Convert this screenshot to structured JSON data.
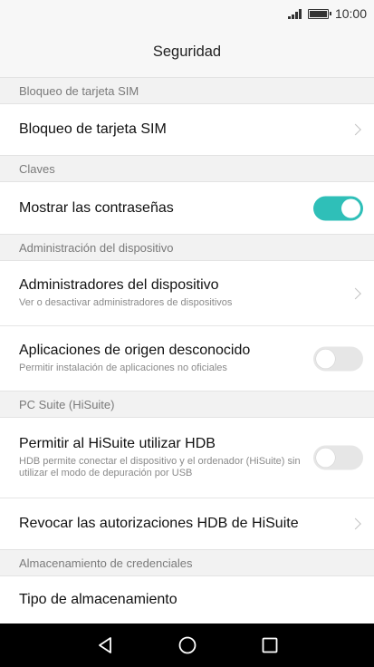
{
  "status_bar": {
    "time": "10:00",
    "icons": [
      "signal-icon",
      "battery-icon"
    ]
  },
  "header": {
    "title": "Seguridad"
  },
  "sections": [
    {
      "title": "Bloqueo de tarjeta SIM",
      "items": [
        {
          "label": "Bloqueo de tarjeta SIM",
          "control": "chevron"
        }
      ]
    },
    {
      "title": "Claves",
      "items": [
        {
          "label": "Mostrar las contraseñas",
          "control": "toggle",
          "state": "on"
        }
      ]
    },
    {
      "title": "Administración del dispositivo",
      "items": [
        {
          "label": "Administradores del dispositivo",
          "subtitle": "Ver o desactivar administradores de dispositivos",
          "control": "chevron"
        },
        {
          "label": "Aplicaciones de origen desconocido",
          "subtitle": "Permitir instalación de aplicaciones no oficiales",
          "control": "toggle",
          "state": "off"
        }
      ]
    },
    {
      "title": "PC Suite (HiSuite)",
      "items": [
        {
          "label": "Permitir al HiSuite utilizar HDB",
          "subtitle": "HDB permite conectar el dispositivo y el ordenador (HiSuite) sin utilizar el modo de depuración por USB",
          "control": "toggle",
          "state": "off"
        },
        {
          "label": "Revocar las autorizaciones HDB de HiSuite",
          "control": "chevron"
        }
      ]
    },
    {
      "title": "Almacenamiento de credenciales",
      "items": [
        {
          "label": "Tipo de almacenamiento"
        }
      ]
    }
  ],
  "nav_bar": {
    "buttons": [
      "back-icon",
      "home-icon",
      "recents-icon"
    ]
  },
  "colors": {
    "accent": "#2fbfb8",
    "navbar": "#000000"
  }
}
